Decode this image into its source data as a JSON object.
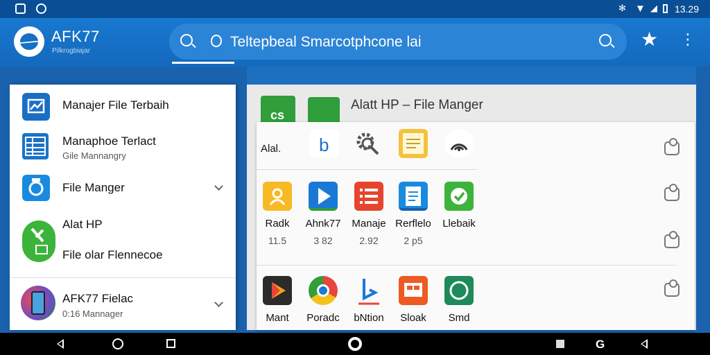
{
  "status_bar": {
    "time": "13.29"
  },
  "app_bar": {
    "brand_name": "AFK77",
    "brand_subtitle": "Pilkrogbiajar",
    "search_text": "Teltepbeal Smarcotphcone lai"
  },
  "drawer": {
    "items": [
      {
        "label": "Manajer File Terbaih",
        "icon": "analytics-icon",
        "color": "#1a6fc4"
      },
      {
        "label": "Manaphoe Terlact",
        "sublabel": "Gile Mannangry",
        "icon": "spreadsheet-icon",
        "color": "#1a73c8"
      },
      {
        "label": "File Manger",
        "icon": "camera-icon",
        "color": "#1a8ae0"
      },
      {
        "label": "Alat HP",
        "icon": "tools-icon",
        "color": "#3cb33a"
      },
      {
        "label": "File olar Flennecoe"
      },
      {
        "label": "AFK77 Fielac",
        "sublabel": "0:16 Mannager",
        "icon": "phone-icon"
      }
    ]
  },
  "grid": {
    "title": "Alatt HP – File Manger",
    "header_icon_label": "Alal.",
    "row1": [
      {
        "icon": "b-logo-icon"
      },
      {
        "icon": "gear-search-icon"
      },
      {
        "icon": "notes-icon"
      },
      {
        "icon": "wireless-icon"
      }
    ],
    "row2": [
      {
        "name": "Radk",
        "value": "11.5",
        "icon": "folder-user-icon"
      },
      {
        "name": "Ahnk77",
        "value": "3 82",
        "icon": "play-icon"
      },
      {
        "name": "Manaje",
        "value": "2.92",
        "icon": "list-icon"
      },
      {
        "name": "Rerflelo",
        "value": "2 p5",
        "icon": "document-icon"
      },
      {
        "name": "Llebaik",
        "icon": "check-icon"
      }
    ],
    "row3": [
      {
        "name": "Mant",
        "icon": "play-store-icon"
      },
      {
        "name": "Poradc",
        "icon": "chrome-icon"
      },
      {
        "name": "bNtion",
        "icon": "bing-icon"
      },
      {
        "name": "Sloak",
        "icon": "slides-icon"
      },
      {
        "name": "Smd",
        "icon": "circle-app-icon"
      }
    ]
  }
}
